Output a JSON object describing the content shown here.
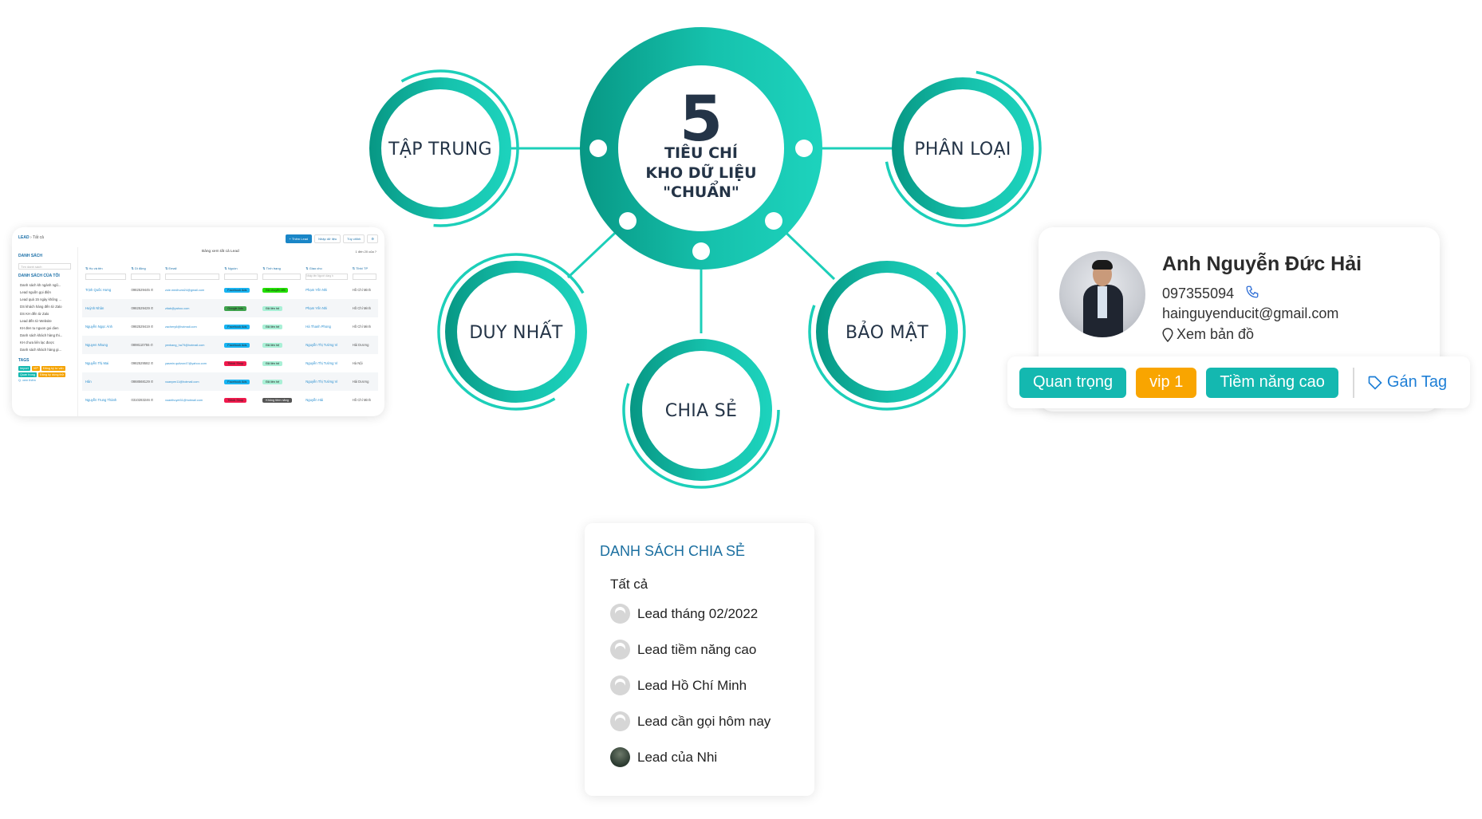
{
  "diagram": {
    "center": {
      "number": "5",
      "line1": "TIÊU CHÍ",
      "line2": "KHO DỮ LIỆU",
      "line3": "\"CHUẨN\""
    },
    "criteria": [
      {
        "id": "tap-trung",
        "label": "TẬP TRUNG"
      },
      {
        "id": "phan-loai",
        "label": "PHÂN LOẠI"
      },
      {
        "id": "duy-nhat",
        "label": "DUY NHẤT"
      },
      {
        "id": "chia-se",
        "label": "CHIA SẺ"
      },
      {
        "id": "bao-mat",
        "label": "BẢO MẬT"
      }
    ],
    "colors": {
      "teal_dark": "#079784",
      "teal_light": "#1ccfb9",
      "text": "#243447"
    }
  },
  "lead_screenshot": {
    "breadcrumb": {
      "root": "LEAD",
      "current": "Tất cả"
    },
    "sidebar": {
      "title": "DANH SÁCH",
      "search_placeholder": "Tìm danh sách",
      "my_lists_title": "DANH SÁCH CỦA TÔI",
      "my_lists": [
        "Danh sách kh ngành ngũ...",
        "Lead nguồn gọi điện",
        "Lead quá 15 ngày không ...",
        "DS khách hàng đến từ Zalo",
        "DS KH đến từ Zalo",
        "Lead đến từ Website",
        "KH đen tu nguon goi dien",
        "Danh sách khách hàng thi...",
        "KH chưa liên lạc được",
        "Danh sách khách hàng gi..."
      ],
      "tags_title": "TAGS",
      "tags": [
        {
          "label": "Import",
          "color": "#14b8b0"
        },
        {
          "label": "VIP",
          "color": "#f5a300"
        },
        {
          "label": "Đăng ký tư vấn",
          "color": "#f5a300"
        },
        {
          "label": "Quan trọng",
          "color": "#14b8b0"
        },
        {
          "label": "Đăng ký dùng thử",
          "color": "#f5a300"
        }
      ],
      "more": "Q. xem thêm"
    },
    "toolbar": {
      "add": "+ Thêm Lead",
      "import": "Nhập dữ liệu",
      "custom": "Tùy chỉnh"
    },
    "table_title": "Bảng xem tất cả Lead",
    "pager": "1 đến 20 của ?",
    "columns": [
      "Họ và tên",
      "Di động",
      "Email",
      "Nguồn",
      "Tình trạng",
      "Giao cho",
      "Tỉnh/ TP"
    ],
    "filter_placeholder": "Nhập tên Người dùng h",
    "rows": [
      {
        "name": "Trịnh Quốc Hưng",
        "phone": "0982529445",
        "email": "zoie.medhurst24@gmail.com",
        "source": "Facebook Ads",
        "source_color": "#18b4f2",
        "status": "Đã chuyển đổi",
        "status_color": "#22e000",
        "owner": "Phạm Yến Nhi",
        "city": "Hồ Chí Minh"
      },
      {
        "name": "Huỳnh Nhân",
        "phone": "0982529429",
        "email": "zitab@yahoo.com",
        "source": "Google Ads",
        "source_color": "#3fa34d",
        "status": "Đã liên hệ",
        "status_color": "#a9f0d6",
        "owner": "Phạm Yến Nhi",
        "city": "Hồ Chí Minh"
      },
      {
        "name": "Nguyễn Ngọc Ánh",
        "phone": "0982529419",
        "email": "zachery6@hotmail.com",
        "source": "Facebook Ads",
        "source_color": "#18b4f2",
        "status": "Đã liên hệ",
        "status_color": "#a9f0d6",
        "owner": "Hà Thanh Phong",
        "city": "Hồ Chí Minh"
      },
      {
        "name": "Nguyen Nhung",
        "phone": "0898110755",
        "email": "yenbang_ha79@hotmail.com",
        "source": "Facebook Ads",
        "source_color": "#18b4f2",
        "status": "Đã liên hệ",
        "status_color": "#a9f0d6",
        "owner": "Nguyễn Thị Tường Vi",
        "city": "Hải Dương"
      },
      {
        "name": "Nguyễn Thị Mai",
        "phone": "0982529582",
        "email": "yasmin.quitzon47@yahoo.com",
        "source": "Tiktok Shop",
        "source_color": "#f0194c",
        "status": "Đã liên hệ",
        "status_color": "#a9f0d6",
        "owner": "Nguyễn Thị Tường Vi",
        "city": "Hà Nội"
      },
      {
        "name": "Hân",
        "phone": "0868568129",
        "email": "xuanyen11@hotmail.com",
        "source": "Facebook Ads",
        "source_color": "#18b4f2",
        "status": "Đã liên hệ",
        "status_color": "#a9f0d6",
        "owner": "Nguyễn Thị Tường Vi",
        "city": "Hải Dương"
      },
      {
        "name": "Nguyễn Trung Thành",
        "phone": "0310283246",
        "email": "xuanthuyet31@hotmail.com",
        "source": "Tiktok Shop",
        "source_color": "#f0194c",
        "status": "Không tiềm năng",
        "status_color": "#555555",
        "owner": "Nguyễn Hải",
        "city": "Hồ Chí Minh"
      }
    ]
  },
  "profile": {
    "name": "Anh Nguyễn Đức Hải",
    "phone": "097355094",
    "email": "hainguyenducit@gmail.com",
    "map_link": "Xem bản đồ",
    "tags": [
      {
        "label": "Quan trọng",
        "color": "#14b8b0"
      },
      {
        "label": "vip 1",
        "color": "#f9a500"
      },
      {
        "label": "Tiềm năng cao",
        "color": "#14b8b0"
      }
    ],
    "assign_tag": "Gán Tag"
  },
  "shared_lists": {
    "title": "DANH SÁCH CHIA SẺ",
    "all": "Tất cả",
    "items": [
      {
        "label": "Lead tháng 02/2022",
        "avatar": "default"
      },
      {
        "label": "Lead tiềm năng cao",
        "avatar": "default"
      },
      {
        "label": "Lead Hồ Chí Minh",
        "avatar": "default"
      },
      {
        "label": "Lead cần gọi hôm nay",
        "avatar": "default"
      },
      {
        "label": "Lead của Nhi",
        "avatar": "photo"
      }
    ]
  }
}
